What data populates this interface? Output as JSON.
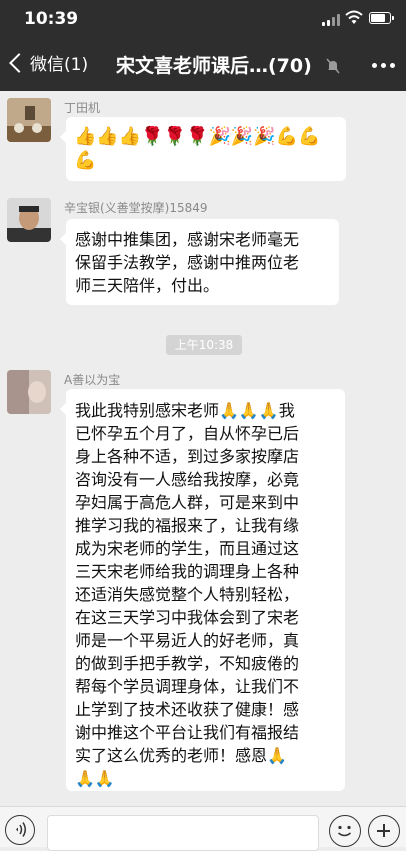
{
  "status_bar": {
    "time": "10:39"
  },
  "nav": {
    "back_label": "微信(1)",
    "title": "宋文喜老师课后…(70)"
  },
  "messages": [
    {
      "sender": "丁田机",
      "emoji_line1": "👍👍👍🌹🌹🌹🎉🎉🎉💪💪",
      "emoji_line2": "💪"
    },
    {
      "sender": "辛宝银(义善堂按摩)15849",
      "lines": [
        "感谢中推集团，感谢宋老师毫无",
        "保留手法教学，感谢中推两位老",
        "师三天陪伴，付出。"
      ]
    },
    {
      "sender": "A善以为宝",
      "lines": [
        "我此我特别感宋老师🙏🙏🙏我",
        "已怀孕五个月了，自从怀孕已后",
        "身上各种不适，到过多家按摩店",
        "咨询没有一人感给我按摩，必竟",
        "孕妇属于高危人群，可是来到中",
        "推学习我的福报来了，让我有缘",
        "成为宋老师的学生，而且通过这",
        "三天宋老师给我的调理身上各种",
        "还适消失感觉整个人特别轻松，",
        "在这三天学习中我体会到了宋老",
        "师是一个平易近人的好老师，真",
        "的做到手把手教学，不知疲倦的",
        "帮每个学员调理身体，让我们不",
        "止学到了技术还收获了健康！感",
        "谢中推这个平台让我们有福报结",
        "实了这么优秀的老师！感恩🙏",
        "🙏🙏"
      ]
    }
  ],
  "timestamp": "上午10:38",
  "colors": {
    "header": "#2e2e2e",
    "chat_bg": "#ededed",
    "bubble": "#ffffff"
  },
  "icons": {
    "signal": "signal-icon",
    "wifi": "wifi-icon",
    "battery": "battery-icon",
    "mute": "mute-icon",
    "more": "more-icon",
    "voice": "voice-icon",
    "emoji": "emoji-icon",
    "plus": "plus-icon"
  },
  "battery_level": 0.8
}
